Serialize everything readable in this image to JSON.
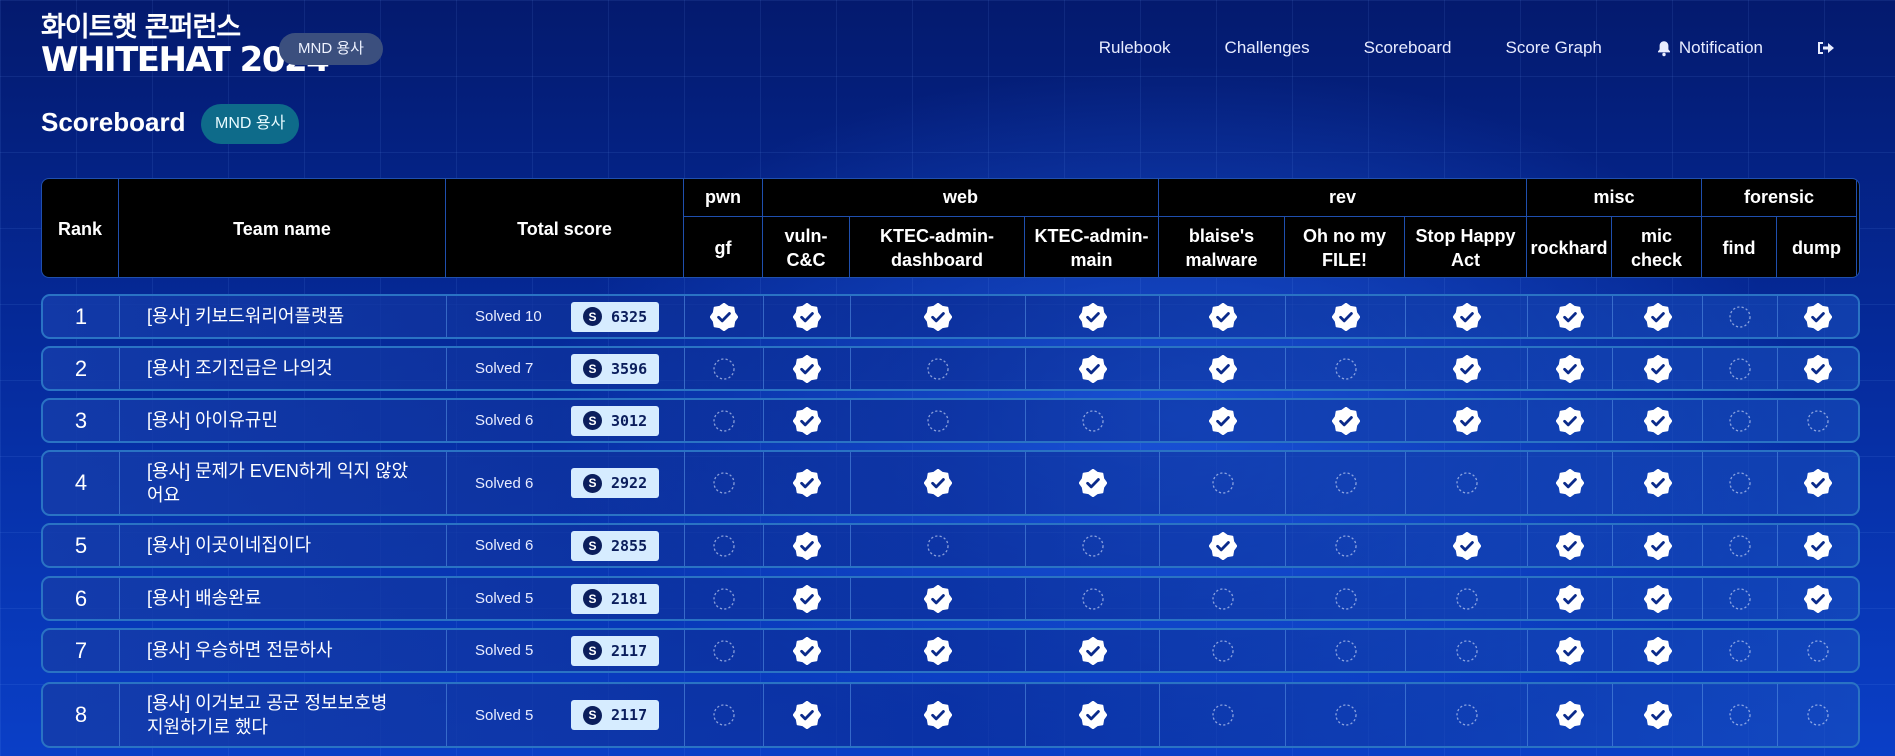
{
  "header": {
    "logo_ko": "화이트햇 콘퍼런스",
    "logo_en": "WHITEHAT 2024",
    "division_badge": "MND 용사",
    "nav": [
      {
        "label": "Rulebook",
        "icon": ""
      },
      {
        "label": "Challenges",
        "icon": ""
      },
      {
        "label": "Scoreboard",
        "icon": ""
      },
      {
        "label": "Score Graph",
        "icon": ""
      },
      {
        "label": "Notification",
        "icon": "bell-icon"
      },
      {
        "label": "",
        "icon": "logout-icon"
      }
    ]
  },
  "page": {
    "title": "Scoreboard",
    "division_badge": "MND 용사"
  },
  "table": {
    "headers": {
      "rank": "Rank",
      "team": "Team name",
      "score": "Total score"
    },
    "categories": [
      {
        "name": "pwn",
        "challenges": [
          "gf"
        ]
      },
      {
        "name": "web",
        "challenges": [
          "vuln-C&C",
          "KTEC-admin-dashboard",
          "KTEC-admin-main"
        ]
      },
      {
        "name": "rev",
        "challenges": [
          "blaise's malware",
          "Oh no my FILE!",
          "Stop Happy Act"
        ]
      },
      {
        "name": "misc",
        "challenges": [
          "rockhard",
          "mic check"
        ]
      },
      {
        "name": "forensic",
        "challenges": [
          "find",
          "dump"
        ]
      }
    ],
    "challenge_header_lines": [
      [
        "gf"
      ],
      [
        "vuln-",
        "C&C"
      ],
      [
        "KTEC-admin-",
        "dashboard"
      ],
      [
        "KTEC-admin-",
        "main"
      ],
      [
        "blaise's",
        "malware"
      ],
      [
        "Oh no my",
        "FILE!"
      ],
      [
        "Stop Happy",
        "Act"
      ],
      [
        "rockhard"
      ],
      [
        "mic",
        "check"
      ],
      [
        "find"
      ],
      [
        "dump"
      ]
    ],
    "score_prefix": "S",
    "rows": [
      {
        "rank": "1",
        "team": "[용사] 키보드워리어플랫폼",
        "solved": "Solved 10",
        "score": "6325",
        "solves": [
          true,
          true,
          true,
          true,
          true,
          true,
          true,
          true,
          true,
          false,
          true
        ]
      },
      {
        "rank": "2",
        "team": "[용사] 조기진급은 나의것",
        "solved": "Solved 7",
        "score": "3596",
        "solves": [
          false,
          true,
          false,
          true,
          true,
          false,
          true,
          true,
          true,
          false,
          true
        ]
      },
      {
        "rank": "3",
        "team": "[용사] 아이유규민",
        "solved": "Solved 6",
        "score": "3012",
        "solves": [
          false,
          true,
          false,
          false,
          true,
          true,
          true,
          true,
          true,
          false,
          false
        ]
      },
      {
        "rank": "4",
        "team": "[용사] 문제가 EVEN하게 익지 않았어요",
        "team_lines": [
          "[용사] 문제가 EVEN하게 익지 않았",
          "어요"
        ],
        "solved": "Solved 6",
        "score": "2922",
        "solves": [
          false,
          true,
          true,
          true,
          false,
          false,
          false,
          true,
          true,
          false,
          true
        ]
      },
      {
        "rank": "5",
        "team": "[용사] 이곳이네집이다",
        "solved": "Solved 6",
        "score": "2855",
        "solves": [
          false,
          true,
          false,
          false,
          true,
          false,
          true,
          true,
          true,
          false,
          true
        ]
      },
      {
        "rank": "6",
        "team": "[용사] 배송완료",
        "solved": "Solved 5",
        "score": "2181",
        "solves": [
          false,
          true,
          true,
          false,
          false,
          false,
          false,
          true,
          true,
          false,
          true
        ]
      },
      {
        "rank": "7",
        "team": "[용사] 우승하면 전문하사",
        "solved": "Solved 5",
        "score": "2117",
        "solves": [
          false,
          true,
          true,
          true,
          false,
          false,
          false,
          true,
          true,
          false,
          false
        ]
      },
      {
        "rank": "8",
        "team": "[용사] 이거보고 공군 정보보호병 지원하기로 했다",
        "team_lines": [
          "[용사] 이거보고 공군 정보보호병",
          "지원하기로 했다"
        ],
        "solved": "Solved 5",
        "score": "2117",
        "solves": [
          false,
          true,
          true,
          true,
          false,
          false,
          false,
          true,
          true,
          false,
          false
        ]
      }
    ]
  }
}
